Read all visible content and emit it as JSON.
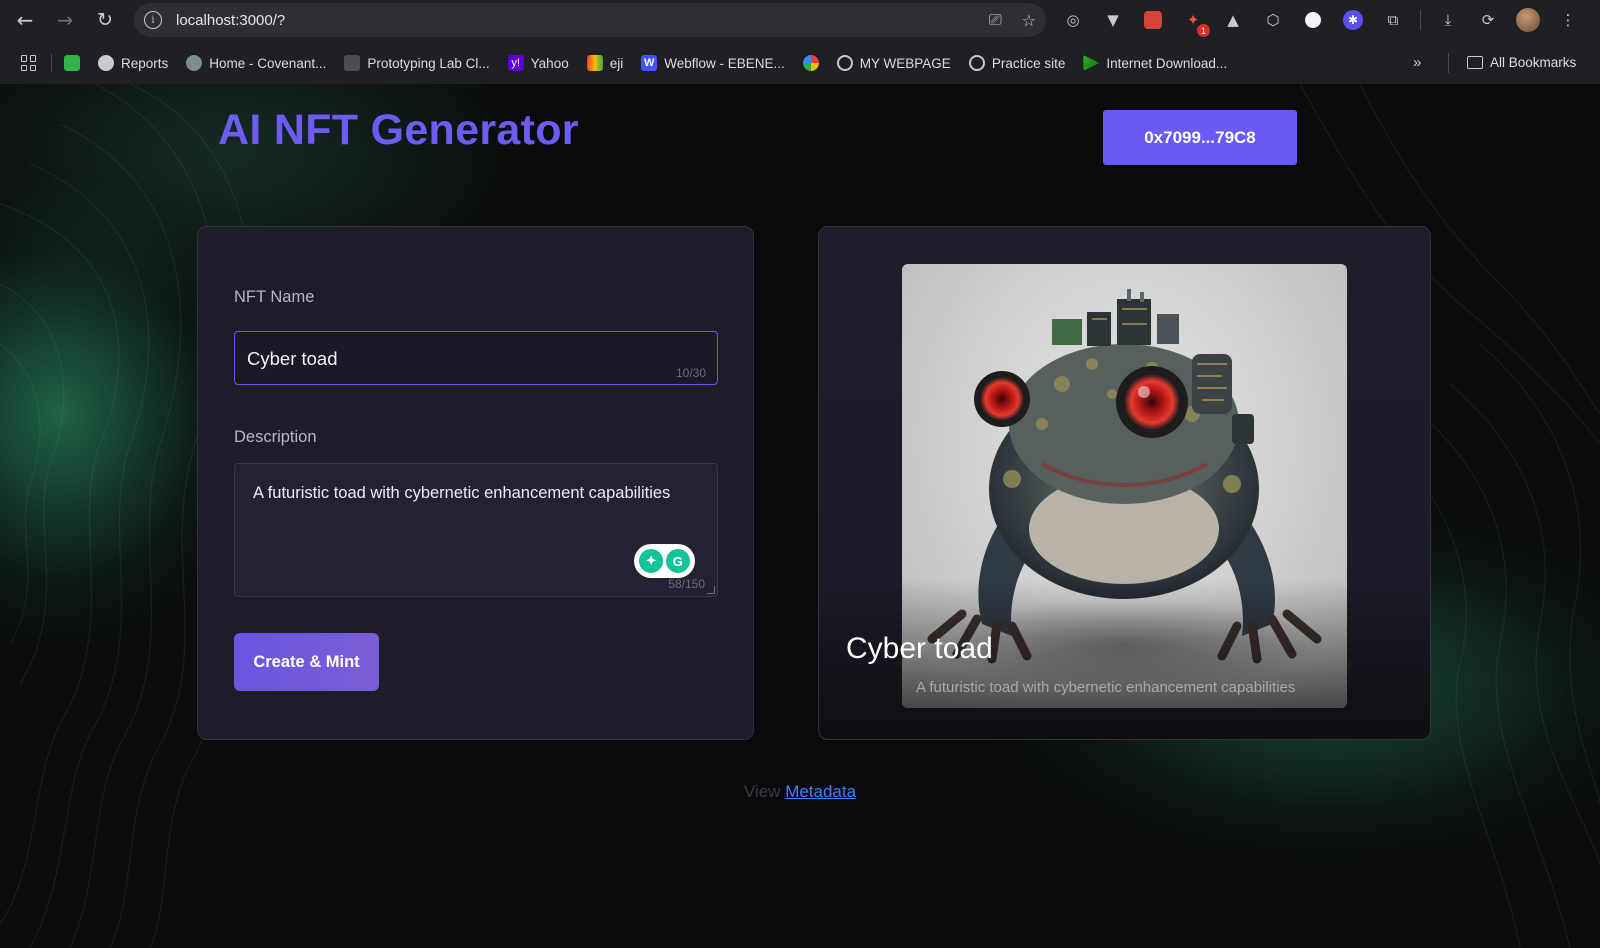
{
  "browser": {
    "url": "localhost:3000/?",
    "extensions": [
      {
        "icon": "target-icon"
      },
      {
        "icon": "vue-icon"
      },
      {
        "icon": "red-extension-icon"
      },
      {
        "icon": "notification-extension-icon",
        "badge": "1"
      },
      {
        "icon": "angular-icon"
      },
      {
        "icon": "cube-icon"
      },
      {
        "icon": "circle-icon"
      },
      {
        "icon": "gear-extension-icon"
      },
      {
        "icon": "puzzle-icon"
      }
    ],
    "bookmarks": [
      {
        "label": "",
        "icon": "green-app-icon"
      },
      {
        "label": "Reports",
        "icon": "reports-icon"
      },
      {
        "label": "Home - Covenant...",
        "icon": "covenant-icon"
      },
      {
        "label": "Prototyping Lab Cl...",
        "icon": "lab-icon"
      },
      {
        "label": "Yahoo",
        "icon": "yahoo-icon"
      },
      {
        "label": "eji",
        "icon": "gmail-icon"
      },
      {
        "label": "Webflow - EBENE...",
        "icon": "webflow-icon"
      },
      {
        "label": "",
        "icon": "photos-icon"
      },
      {
        "label": "MY WEBPAGE",
        "icon": "globe-icon"
      },
      {
        "label": "Practice site",
        "icon": "globe-icon"
      },
      {
        "label": "Internet Download...",
        "icon": "idm-icon"
      }
    ],
    "all_bookmarks": "All Bookmarks"
  },
  "header": {
    "title": "AI NFT Generator",
    "wallet": "0x7099...79C8"
  },
  "form": {
    "name_label": "NFT Name",
    "name_value": "Cyber toad",
    "name_counter": "10/30",
    "desc_label": "Description",
    "desc_value": "A futuristic toad with cybernetic enhancement capabilities",
    "desc_counter": "58/150",
    "submit_label": "Create & Mint"
  },
  "preview": {
    "title": "Cyber toad",
    "description": "A futuristic toad with cybernetic enhancement capabilities"
  },
  "footer": {
    "prefix": "View",
    "link": "Metadata"
  },
  "colors": {
    "accent": "#6a59f3",
    "brand": "#6d5cf0",
    "link": "#3b82f6",
    "background": "#0b0b0d",
    "card": "#1d1c29"
  }
}
